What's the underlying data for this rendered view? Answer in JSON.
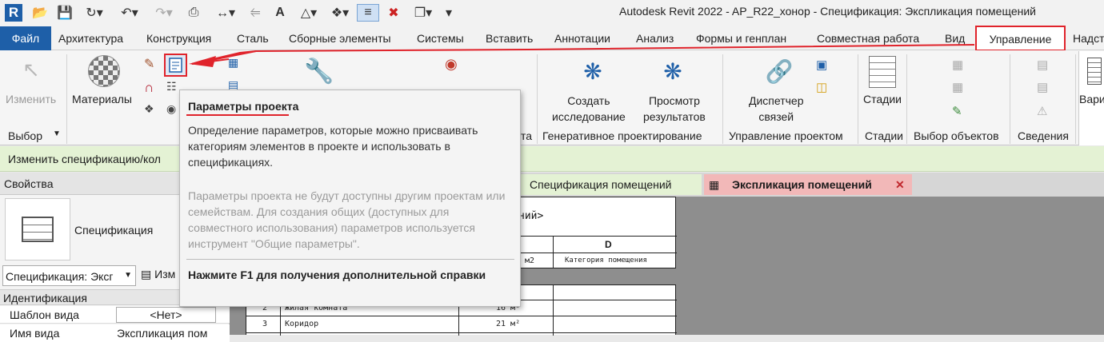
{
  "app": {
    "title": "Autodesk Revit 2022 - AP_R22_хонор - Спецификация: Экспликация помещений"
  },
  "quick_access": {
    "app_letter": "R"
  },
  "menu": {
    "file": "Файл",
    "tabs": [
      "Архитектура",
      "Конструкция",
      "Сталь",
      "Сборные элементы",
      "Системы",
      "Вставить",
      "Аннотации",
      "Анализ",
      "Формы и генплан",
      "Совместная работа",
      "Вид",
      "Управление",
      "Надст"
    ],
    "active": "Управление"
  },
  "ribbon": {
    "modify": "Изменить",
    "select_group": "Выбор",
    "materials": "Материалы",
    "panel_a_fragment": "та",
    "create_study": [
      "Создать",
      "исследование"
    ],
    "explore_outcomes": [
      "Просмотр",
      "результатов"
    ],
    "generative_design": "Генеративное проектирование",
    "manage_links": [
      "Диспетчер",
      "связей"
    ],
    "manage_project": "Управление проектом",
    "phases": "Стадии",
    "phases_group": "Стадии",
    "selection_group": "Выбор объектов",
    "inquiry_group": "Сведения",
    "variants_fragment": "Вари"
  },
  "context_bar": {
    "text": "Изменить спецификацию/кол"
  },
  "properties": {
    "header": "Свойства",
    "type_name": "Спецификация",
    "selector_value": "Спецификация: Эксг",
    "edit_type_fragment": "Изм",
    "section": "Идентификация",
    "rows": [
      {
        "name": "Шаблон вида",
        "value": "<Нет>"
      },
      {
        "name": "Имя вида",
        "value": "Экспликация пом"
      }
    ]
  },
  "view_tabs": [
    {
      "label": "Спецификация помещений",
      "active": false
    },
    {
      "label": "Экспликация помещений",
      "active": true
    }
  ],
  "schedule": {
    "title_fragment": "ний>",
    "col_d": "D",
    "unit_header": "м2",
    "col_d_header": "Категория помещения",
    "rows": [
      {
        "num": "2",
        "name": "Жилая комната",
        "area": "16 м²"
      },
      {
        "num": "3",
        "name": "Коридор",
        "area": "21 м²"
      }
    ]
  },
  "tooltip": {
    "title": "Параметры проекта",
    "description": "Определение параметров, которые можно присваивать категориям элементов в проекте и использовать в спецификациях.",
    "note": "Параметры проекта не будут доступны другим проектам или семействам. Для создания общих (доступных для совместного использования) параметров используется инструмент \"Общие параметры\".",
    "help": "Нажмите F1 для получения дополнительной справки"
  },
  "colors": {
    "accent": "#1e5fa8",
    "annotation": "#e0232b",
    "context_bar": "#e4f2d4",
    "active_tab": "#f2b8b8"
  }
}
